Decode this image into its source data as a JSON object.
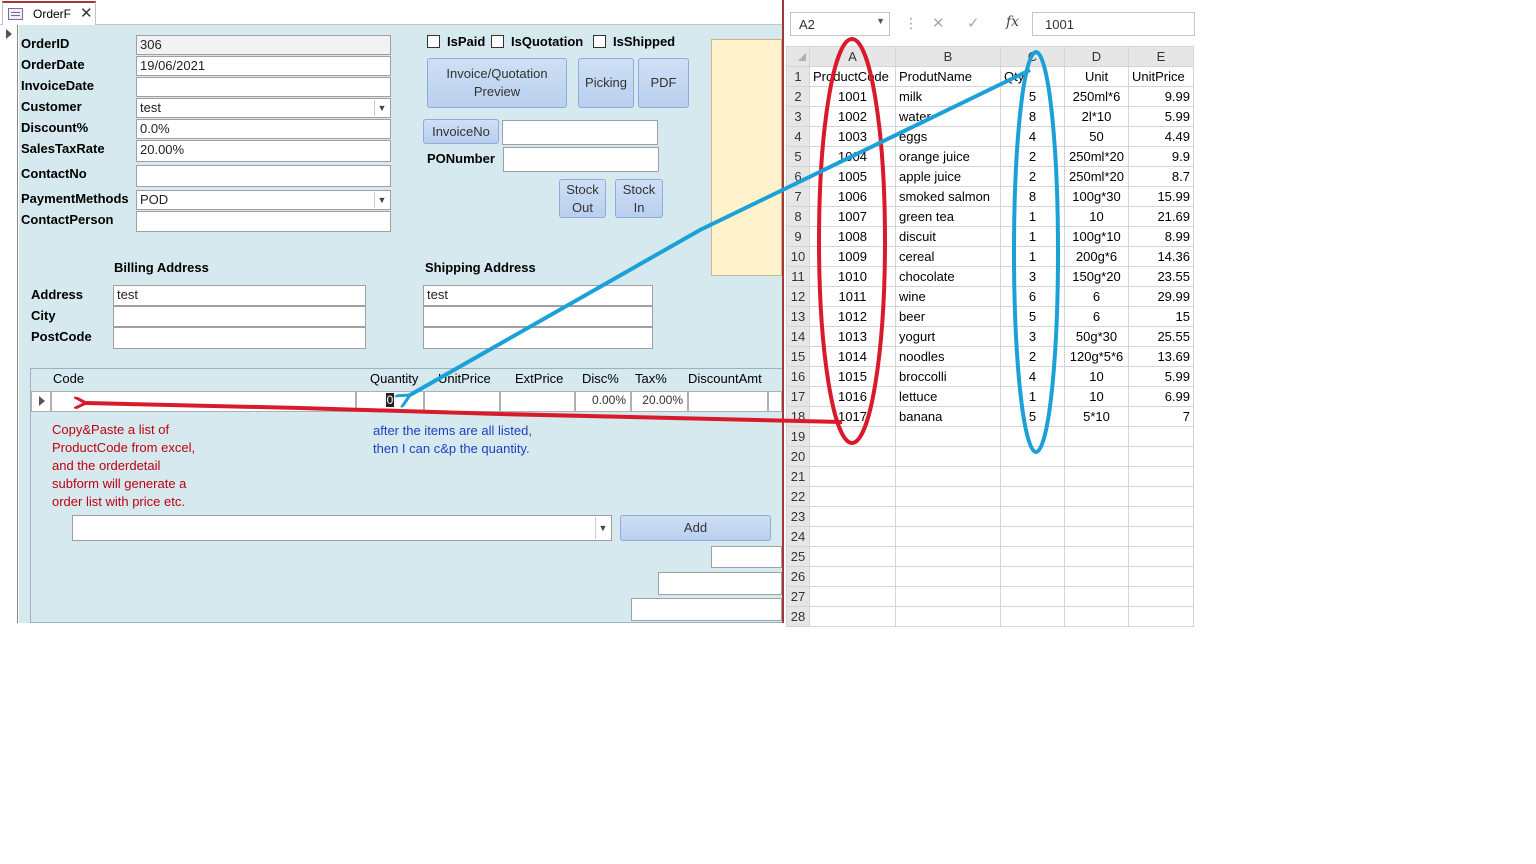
{
  "access": {
    "tab_label": "OrderF",
    "fields": {
      "order_id": {
        "label": "OrderID",
        "value": "306"
      },
      "order_date": {
        "label": "OrderDate",
        "value": "19/06/2021"
      },
      "invoice_date": {
        "label": "InvoiceDate",
        "value": ""
      },
      "customer": {
        "label": "Customer",
        "value": "test"
      },
      "discount": {
        "label": "Discount%",
        "value": "0.0%"
      },
      "sales_tax": {
        "label": "SalesTaxRate",
        "value": "20.00%"
      },
      "contact_no": {
        "label": "ContactNo",
        "value": ""
      },
      "payment": {
        "label": "PaymentMethods",
        "value": "POD"
      },
      "contact_person": {
        "label": "ContactPerson",
        "value": ""
      }
    },
    "checkboxes": {
      "is_paid": "IsPaid",
      "is_quotation": "IsQuotation",
      "is_shipped": "IsShipped"
    },
    "buttons": {
      "invoice_preview": "Invoice/Quotation Preview",
      "picking": "Picking",
      "pdf": "PDF",
      "invoice_no": "InvoiceNo",
      "stock_out": "Stock Out",
      "stock_in": "Stock In",
      "add": "Add"
    },
    "po_number_label": "PONumber",
    "billing": {
      "title": "Billing Address",
      "address_label": "Address",
      "city_label": "City",
      "postcode_label": "PostCode",
      "address": "test",
      "city": "",
      "postcode": ""
    },
    "shipping": {
      "title": "Shipping Address",
      "address": "test",
      "city": "",
      "postcode": ""
    },
    "subform": {
      "headers": {
        "code": "Code",
        "quantity": "Quantity",
        "unit_price": "UnitPrice",
        "ext_price": "ExtPrice",
        "disc": "Disc%",
        "tax": "Tax%",
        "discount_amt": "DiscountAmt"
      },
      "row": {
        "quantity": "0",
        "disc": "0.00%",
        "tax": "20.00%"
      }
    },
    "notes": {
      "red": [
        "Copy&Paste a list of",
        "ProductCode from excel,",
        "and the orderdetail",
        "subform will generate a",
        "order list with price etc."
      ],
      "blue": [
        "after the items are all listed,",
        "then I can c&p the quantity."
      ]
    }
  },
  "excel": {
    "name_box": "A2",
    "fx_symbol": "fx",
    "formula_value": "1001",
    "columns": [
      "A",
      "B",
      "C",
      "D",
      "E"
    ],
    "header_row": [
      "ProductCode",
      "ProdutName",
      "Qty",
      "Unit",
      "UnitPrice"
    ],
    "rows": [
      [
        "1001",
        "milk",
        "5",
        "250ml*6",
        "9.99"
      ],
      [
        "1002",
        "water",
        "8",
        "2l*10",
        "5.99"
      ],
      [
        "1003",
        "eggs",
        "4",
        "50",
        "4.49"
      ],
      [
        "1004",
        "orange juice",
        "2",
        "250ml*20",
        "9.9"
      ],
      [
        "1005",
        "apple juice",
        "2",
        "250ml*20",
        "8.7"
      ],
      [
        "1006",
        "smoked salmon",
        "8",
        "100g*30",
        "15.99"
      ],
      [
        "1007",
        "green tea",
        "1",
        "10",
        "21.69"
      ],
      [
        "1008",
        "discuit",
        "1",
        "100g*10",
        "8.99"
      ],
      [
        "1009",
        "cereal",
        "1",
        "200g*6",
        "14.36"
      ],
      [
        "1010",
        "chocolate",
        "3",
        "150g*20",
        "23.55"
      ],
      [
        "1011",
        "wine",
        "6",
        "6",
        "29.99"
      ],
      [
        "1012",
        "beer",
        "5",
        "6",
        "15"
      ],
      [
        "1013",
        "yogurt",
        "3",
        "50g*30",
        "25.55"
      ],
      [
        "1014",
        "noodles",
        "2",
        "120g*5*6",
        "13.69"
      ],
      [
        "1015",
        "broccolli",
        "4",
        "10",
        "5.99"
      ],
      [
        "1016",
        "lettuce",
        "1",
        "10",
        "6.99"
      ],
      [
        "1017",
        "banana",
        "5",
        "5*10",
        "7"
      ]
    ],
    "row_numbers": [
      "1",
      "2",
      "3",
      "4",
      "5",
      "6",
      "7",
      "8",
      "9",
      "10",
      "11",
      "12",
      "13",
      "14",
      "15",
      "16",
      "17",
      "18",
      "19",
      "20",
      "21",
      "22",
      "23",
      "24",
      "25",
      "26",
      "27",
      "28"
    ]
  },
  "colors": {
    "annotation_red": "#d91a2a",
    "annotation_blue": "#1ca0d8",
    "form_bg": "#d5e9ef"
  }
}
